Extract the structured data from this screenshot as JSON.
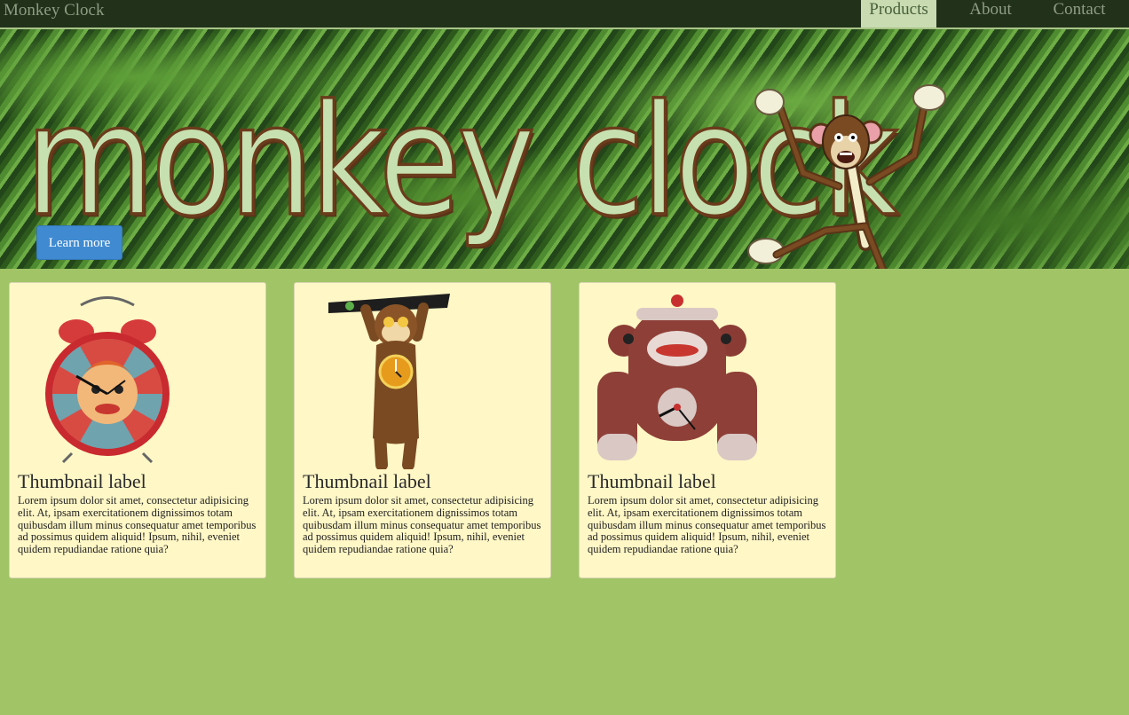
{
  "navbar": {
    "brand": "Monkey Clock",
    "items": [
      {
        "label": "Products",
        "active": true
      },
      {
        "label": "About",
        "active": false
      },
      {
        "label": "Contact",
        "active": false
      }
    ]
  },
  "hero": {
    "title": "monkey clock",
    "button_label": "Learn more"
  },
  "cards": [
    {
      "title": "Thumbnail label",
      "text": "Lorem ipsum dolor sit amet, consectetur adipisicing elit. At, ipsam exercitationem dignissimos totam quibusdam illum minus consequatur amet temporibus ad possimus quidem aliquid! Ipsum, nihil, eveniet quidem repudiandae ratione quia?",
      "image": "alarm-clock-monkey-image"
    },
    {
      "title": "Thumbnail label",
      "text": "Lorem ipsum dolor sit amet, consectetur adipisicing elit. At, ipsam exercitationem dignissimos totam quibusdam illum minus consequatur amet temporibus ad possimus quidem aliquid! Ipsum, nihil, eveniet quidem repudiandae ratione quia?",
      "image": "hanging-monkey-clock-image"
    },
    {
      "title": "Thumbnail label",
      "text": "Lorem ipsum dolor sit amet, consectetur adipisicing elit. At, ipsam exercitationem dignissimos totam quibusdam illum minus consequatur amet temporibus ad possimus quidem aliquid! Ipsum, nihil, eveniet quidem repudiandae ratione quia?",
      "image": "sock-monkey-clock-image"
    }
  ],
  "colors": {
    "page_bg": "#a0c466",
    "navbar_bg": "#22311a",
    "card_bg": "#fff7c6",
    "button_bg": "#3f8ad0"
  }
}
